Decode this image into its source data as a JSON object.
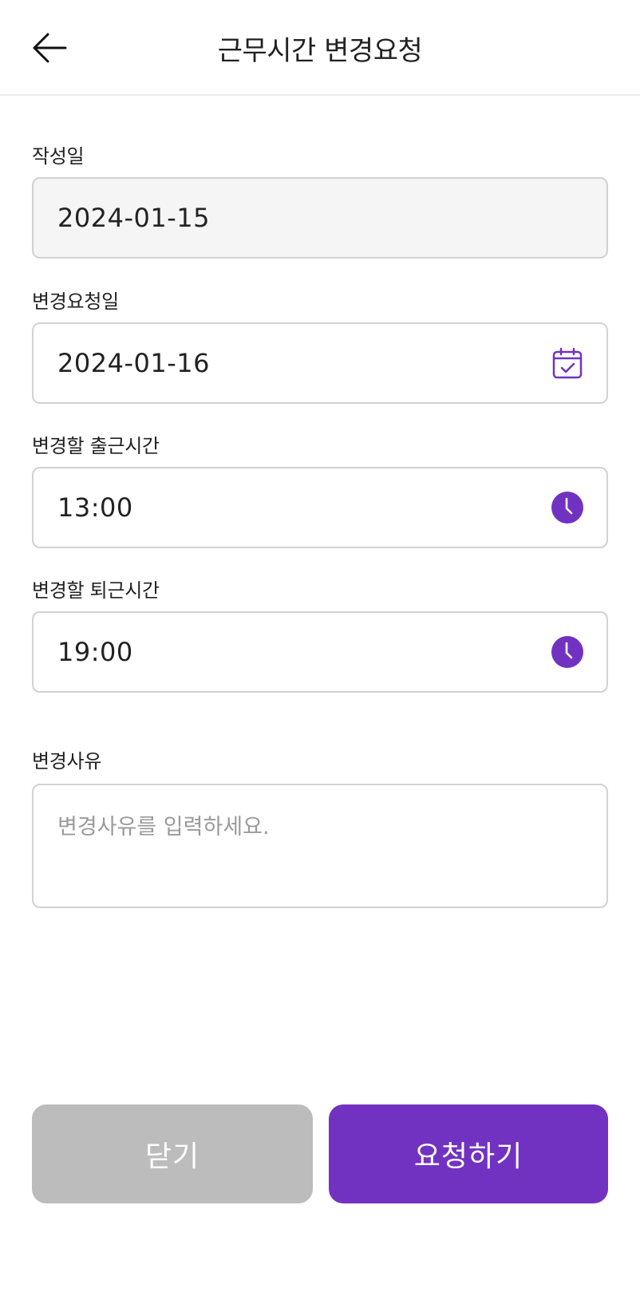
{
  "header": {
    "title": "근무시간 변경요청"
  },
  "form": {
    "created_date": {
      "label": "작성일",
      "value": "2024-01-15"
    },
    "request_date": {
      "label": "변경요청일",
      "value": "2024-01-16",
      "icon": "calendar-check-icon"
    },
    "start_time": {
      "label": "변경할 출근시간",
      "value": "13:00",
      "icon": "clock-icon"
    },
    "end_time": {
      "label": "변경할 퇴근시간",
      "value": "19:00",
      "icon": "clock-icon"
    },
    "reason": {
      "label": "변경사유",
      "placeholder": "변경사유를 입력하세요.",
      "value": ""
    }
  },
  "actions": {
    "close_label": "닫기",
    "submit_label": "요청하기"
  },
  "colors": {
    "accent": "#7232c1",
    "disabled_button": "#bcbcbc",
    "border": "#d2d2d2",
    "readonly_bg": "#f5f5f5"
  }
}
